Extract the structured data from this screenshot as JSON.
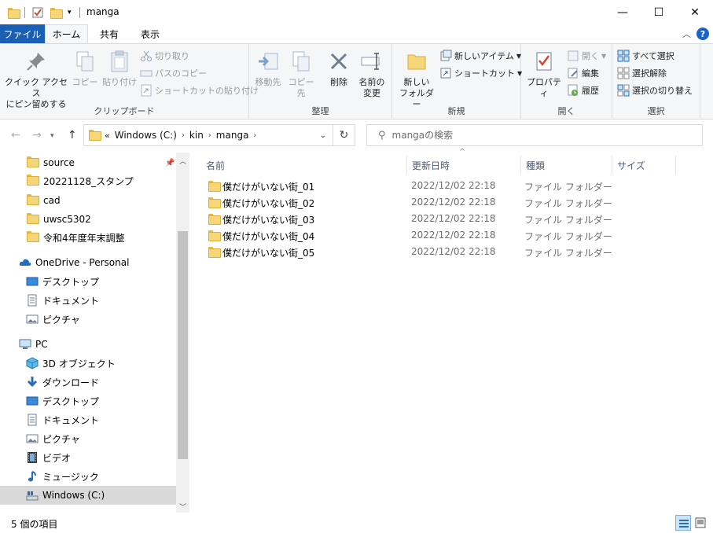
{
  "window": {
    "title": "manga",
    "minimize": "—",
    "maximize": "☐",
    "close": "✕"
  },
  "tabs": {
    "file": "ファイル",
    "home": "ホーム",
    "share": "共有",
    "view": "表示"
  },
  "ribbon": {
    "clipboard": {
      "label": "クリップボード",
      "pin_quick": "クイック アクセス\nにピン留めする",
      "copy": "コピー",
      "paste": "貼り付け",
      "cut": "切り取り",
      "copy_path": "パスのコピー",
      "paste_shortcut": "ショートカットの貼り付け"
    },
    "organize": {
      "label": "整理",
      "move_to": "移動先",
      "copy_to": "コピー先",
      "delete": "削除",
      "rename": "名前の\n変更"
    },
    "new": {
      "label": "新規",
      "new_folder": "新しい\nフォルダー",
      "new_item": "新しいアイテム",
      "shortcut": "ショートカット"
    },
    "open": {
      "label": "開く",
      "properties": "プロパティ",
      "open": "開く",
      "edit": "編集",
      "history": "履歴"
    },
    "select": {
      "label": "選択",
      "select_all": "すべて選択",
      "select_none": "選択解除",
      "invert": "選択の切り替え"
    }
  },
  "address": {
    "overflow": "«",
    "crumbs": [
      "Windows (C:)",
      "kin",
      "manga"
    ],
    "search_placeholder": "mangaの検索"
  },
  "nav": {
    "quick": [
      {
        "label": "source"
      },
      {
        "label": "20221128_スタンプ"
      },
      {
        "label": "cad"
      },
      {
        "label": "uwsc5302"
      },
      {
        "label": "令和4年度年末調整"
      }
    ],
    "onedrive": "OneDrive - Personal",
    "onedrive_items": [
      "デスクトップ",
      "ドキュメント",
      "ピクチャ"
    ],
    "pc": "PC",
    "pc_items": [
      "3D オブジェクト",
      "ダウンロード",
      "デスクトップ",
      "ドキュメント",
      "ピクチャ",
      "ビデオ",
      "ミュージック",
      "Windows (C:)"
    ]
  },
  "columns": {
    "name": "名前",
    "date": "更新日時",
    "type": "種類",
    "size": "サイズ"
  },
  "files": [
    {
      "name": "僕だけがいない街_01",
      "date": "2022/12/02 22:18",
      "type": "ファイル フォルダー"
    },
    {
      "name": "僕だけがいない街_02",
      "date": "2022/12/02 22:18",
      "type": "ファイル フォルダー"
    },
    {
      "name": "僕だけがいない街_03",
      "date": "2022/12/02 22:18",
      "type": "ファイル フォルダー"
    },
    {
      "name": "僕だけがいない街_04",
      "date": "2022/12/02 22:18",
      "type": "ファイル フォルダー"
    },
    {
      "name": "僕だけがいない街_05",
      "date": "2022/12/02 22:18",
      "type": "ファイル フォルダー"
    }
  ],
  "status": {
    "count": "5 個の項目"
  },
  "colors": {
    "accent": "#1a5fb4",
    "folder": "#f7d67a",
    "selected": "#d9d9d9"
  }
}
